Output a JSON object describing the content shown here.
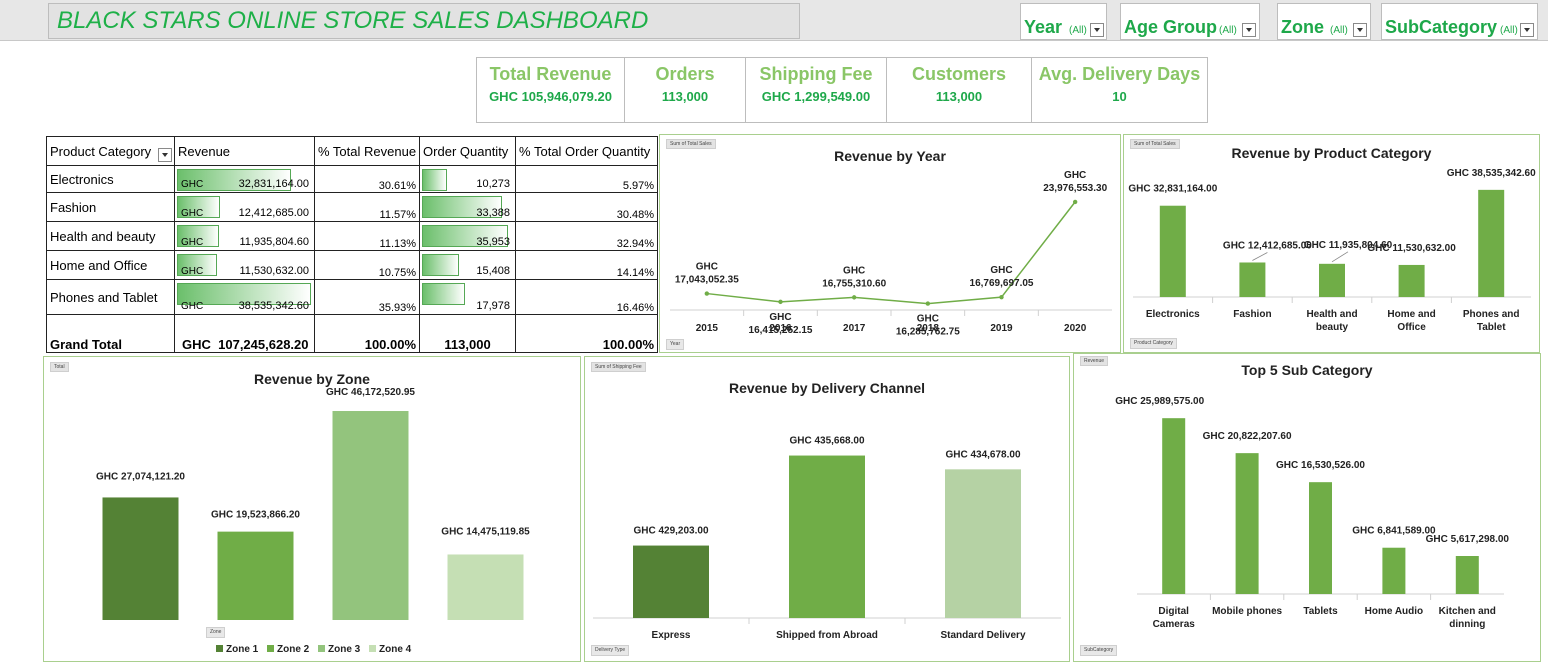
{
  "title": "BLACK STARS ONLINE STORE SALES DASHBOARD",
  "filters": [
    {
      "label": "Year",
      "value": "(All)"
    },
    {
      "label": "Age Group",
      "value": "(All)"
    },
    {
      "label": "Zone",
      "value": "(All)"
    },
    {
      "label": "SubCategory",
      "value": "(All)"
    }
  ],
  "kpis": [
    {
      "label": "Total Revenue",
      "value": "GHC 105,946,079.20"
    },
    {
      "label": "Orders",
      "value": "113,000"
    },
    {
      "label": "Shipping Fee",
      "value": "GHC 1,299,549.00"
    },
    {
      "label": "Customers",
      "value": "113,000"
    },
    {
      "label": "Avg. Delivery Days",
      "value": "10"
    }
  ],
  "table": {
    "headers": [
      "Product Category",
      "Revenue",
      "% Total Revenue",
      "Order Quantity",
      "% Total Order Quantity"
    ],
    "rows": [
      {
        "category": "Electronics",
        "cur": "GHC",
        "revenue": "32,831,164.00",
        "pct_rev": "30.61%",
        "qty": "10,273",
        "pct_qty": "5.97%",
        "rev_frac": 0.852,
        "qty_frac": 0.286
      },
      {
        "category": "Fashion",
        "cur": "GHC",
        "revenue": "12,412,685.00",
        "pct_rev": "11.57%",
        "qty": "33,388",
        "pct_qty": "30.48%",
        "rev_frac": 0.322,
        "qty_frac": 0.929
      },
      {
        "category": "Health and beauty",
        "cur": "GHC",
        "revenue": "11,935,804.60",
        "pct_rev": "11.13%",
        "qty": "35,953",
        "pct_qty": "32.94%",
        "rev_frac": 0.31,
        "qty_frac": 1.0
      },
      {
        "category": "Home and Office",
        "cur": "GHC",
        "revenue": "11,530,632.00",
        "pct_rev": "10.75%",
        "qty": "15,408",
        "pct_qty": "14.14%",
        "rev_frac": 0.299,
        "qty_frac": 0.429
      },
      {
        "category": "Phones and Tablet",
        "cur": "GHC",
        "revenue": "38,535,342.60",
        "pct_rev": "35.93%",
        "qty": "17,978",
        "pct_qty": "16.46%",
        "rev_frac": 1.0,
        "qty_frac": 0.5
      }
    ],
    "total": {
      "label": "Grand Total",
      "cur": "GHC",
      "revenue": "107,245,628.20",
      "pct_rev": "100.00%",
      "qty": "113,000",
      "pct_qty": "100.00%"
    }
  },
  "charts": {
    "year": {
      "tag": "Sum of Total Sales",
      "button": "Year"
    },
    "category": {
      "tag": "Sum of Total Sales",
      "button": "Product Category"
    },
    "zone": {
      "tag": "Total",
      "button": "Zone"
    },
    "channel": {
      "tag": "Sum of Shipping Fee",
      "button": "Delivery Type"
    },
    "sub": {
      "tag": "Revenue",
      "button": "SubCategory"
    }
  },
  "chart_data": [
    {
      "type": "line",
      "title": "Revenue by Year",
      "x": [
        "2015",
        "2016",
        "2017",
        "2018",
        "2019",
        "2020"
      ],
      "values": [
        17043052.35,
        16415252.15,
        16755310.6,
        16285762.75,
        16769697.05,
        23976553.3
      ],
      "labels": [
        "GHC 17,043,052.35",
        "GHC 16,415,252.15",
        "GHC 16,755,310.60",
        "GHC 16,285,762.75",
        "GHC 16,769,697.05",
        "GHC 23,976,553.30"
      ],
      "color": "#70ad47"
    },
    {
      "type": "bar",
      "title": "Revenue by Product Category",
      "categories": [
        "Electronics",
        "Fashion",
        "Health and beauty",
        "Home and Office",
        "Phones and Tablet"
      ],
      "values": [
        32831164.0,
        12412685.0,
        11935804.6,
        11530632.0,
        38535342.6
      ],
      "labels": [
        "GHC 32,831,164.00",
        "GHC 12,412,685.00",
        "GHC 11,935,804.60",
        "GHC 11,530,632.00",
        "GHC 38,535,342.60"
      ],
      "color": "#70ad47"
    },
    {
      "type": "bar",
      "title": "Revenue by Zone",
      "categories": [
        "Zone 1",
        "Zone 2",
        "Zone 3",
        "Zone 4"
      ],
      "values": [
        27074121.2,
        19523866.2,
        46172520.95,
        14475119.85
      ],
      "labels": [
        "GHC 27,074,121.20",
        "GHC 19,523,866.20",
        "GHC 46,172,520.95",
        "GHC 14,475,119.85"
      ],
      "legend": [
        "Zone 1",
        "Zone 2",
        "Zone 3",
        "Zone 4"
      ],
      "colors": [
        "#548235",
        "#70ad47",
        "#93c47d",
        "#c5dfb4"
      ]
    },
    {
      "type": "bar",
      "title": "Revenue by Delivery Channel",
      "categories": [
        "Express",
        "Shipped from Abroad",
        "Standard Delivery"
      ],
      "values": [
        429203.0,
        435668.0,
        434678.0
      ],
      "labels": [
        "GHC 429,203.00",
        "GHC 435,668.00",
        "GHC 434,678.00"
      ],
      "colors": [
        "#548235",
        "#70ad47",
        "#b5d2a4"
      ]
    },
    {
      "type": "bar",
      "title": "Top 5 Sub Category",
      "categories": [
        "Digital Cameras",
        "Mobile phones",
        "Tablets",
        "Home Audio",
        "Kitchen and dinning"
      ],
      "values": [
        25989575.0,
        20822207.6,
        16530526.0,
        6841589.0,
        5617298.0
      ],
      "labels": [
        "GHC 25,989,575.00",
        "GHC 20,822,207.60",
        "GHC 16,530,526.00",
        "GHC 6,841,589.00",
        "GHC 5,617,298.00"
      ],
      "color": "#70ad47"
    }
  ]
}
